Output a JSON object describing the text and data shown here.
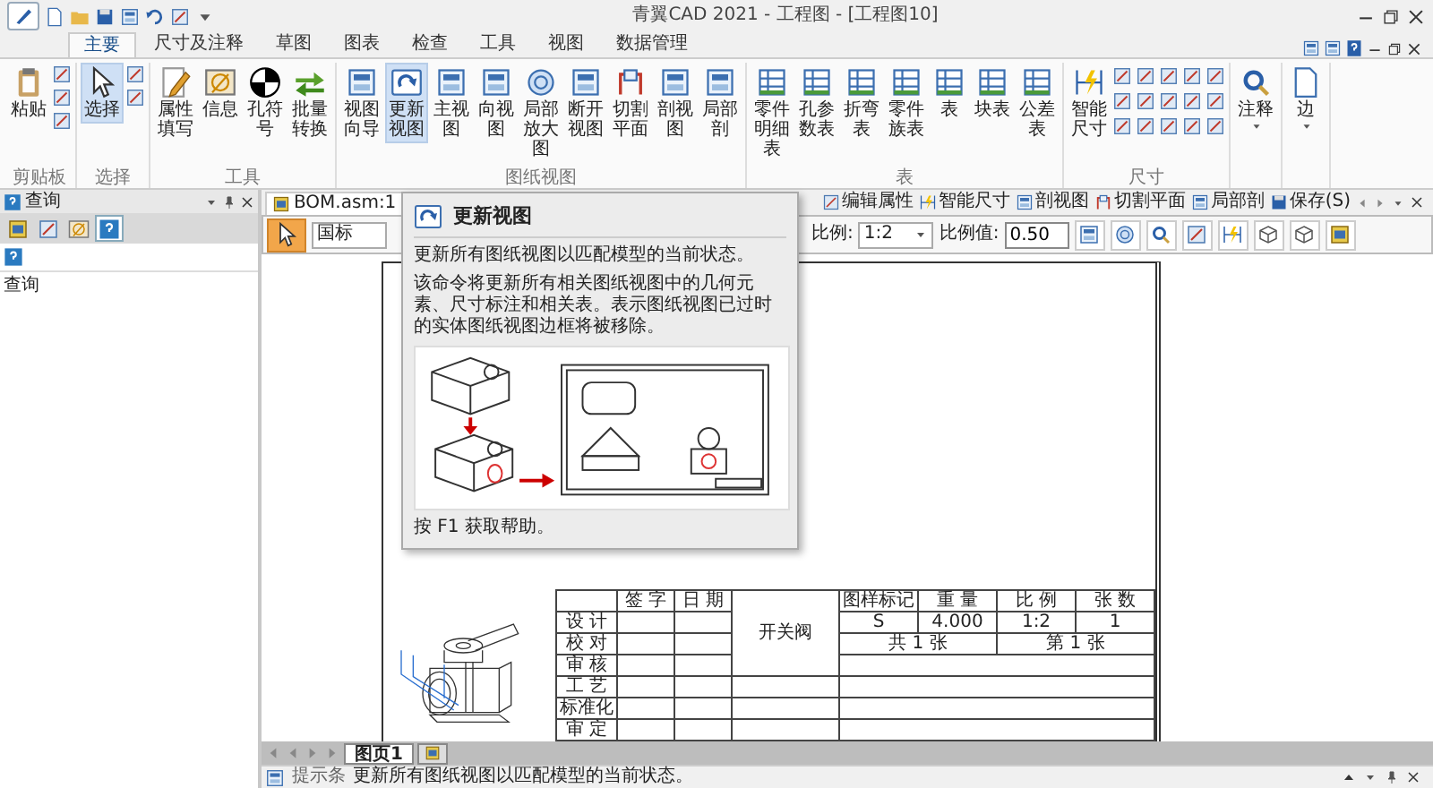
{
  "window": {
    "title": "青翼CAD 2021 - 工程图 - [工程图10]"
  },
  "ribbon_tabs": [
    {
      "label": "主要",
      "selected": true
    },
    {
      "label": "尺寸及注释",
      "selected": false
    },
    {
      "label": "草图",
      "selected": false
    },
    {
      "label": "图表",
      "selected": false
    },
    {
      "label": "检查",
      "selected": false
    },
    {
      "label": "工具",
      "selected": false
    },
    {
      "label": "视图",
      "selected": false
    },
    {
      "label": "数据管理",
      "selected": false
    }
  ],
  "ribbon_groups": [
    {
      "kind": "clipboard",
      "label": "剪贴板",
      "buttons": [
        {
          "label": "粘贴",
          "selected": false
        }
      ]
    },
    {
      "kind": "select",
      "label": "选择",
      "buttons": [
        {
          "label": "选择",
          "selected": true
        }
      ]
    },
    {
      "kind": "tools",
      "label": "工具",
      "buttons": [
        {
          "label": "属性填写",
          "selected": false
        },
        {
          "label": "信息",
          "selected": false
        },
        {
          "label": "孔符号",
          "selected": false
        },
        {
          "label": "批量转换",
          "selected": false
        }
      ]
    },
    {
      "kind": "views",
      "label": "图纸视图",
      "buttons": [
        {
          "label": "视图向导",
          "selected": false
        },
        {
          "label": "更新视图",
          "selected": true
        },
        {
          "label": "主视图",
          "selected": false
        },
        {
          "label": "向视图",
          "selected": false
        },
        {
          "label": "局部放大图",
          "selected": false
        },
        {
          "label": "断开视图",
          "selected": false
        },
        {
          "label": "切割平面",
          "selected": false
        },
        {
          "label": "剖视图",
          "selected": false
        },
        {
          "label": "局部剖",
          "selected": false
        }
      ]
    },
    {
      "kind": "tables",
      "label": "表",
      "buttons": [
        {
          "label": "零件明细表",
          "selected": false
        },
        {
          "label": "孔参数表",
          "selected": false
        },
        {
          "label": "折弯表",
          "selected": false
        },
        {
          "label": "零件族表",
          "selected": false
        },
        {
          "label": "表",
          "selected": false
        },
        {
          "label": "块表",
          "selected": false
        },
        {
          "label": "公差表",
          "selected": false
        }
      ]
    },
    {
      "kind": "dimensions",
      "label": "尺寸",
      "buttons": [
        {
          "label": "智能尺寸",
          "selected": false
        }
      ]
    },
    {
      "kind": "annotation",
      "buttons": [
        {
          "label": "注释",
          "selected": false
        }
      ]
    },
    {
      "kind": "edge",
      "buttons": [
        {
          "label": "边",
          "selected": false
        }
      ]
    }
  ],
  "left_panel": {
    "title": "查询",
    "tabs": [
      {
        "selected": false
      },
      {
        "selected": false
      },
      {
        "selected": false
      },
      {
        "selected": true
      }
    ],
    "item": "查询"
  },
  "document_tab": {
    "label": "BOM.asm:1"
  },
  "quick_toolbar": [
    {
      "label": "编辑属性"
    },
    {
      "label": "智能尺寸"
    },
    {
      "label": "剖视图"
    },
    {
      "label": "切割平面"
    },
    {
      "label": "局部剖"
    },
    {
      "label": "保存(S)"
    }
  ],
  "drawing_toolbar": {
    "select_active": true,
    "standard": "国标",
    "scale_label": "比例:",
    "scale": "1:2",
    "scale_value_label": "比例值:",
    "scale_value": "0.50"
  },
  "tooltip": {
    "title": "更新视图",
    "summary": "更新所有图纸视图以匹配模型的当前状态。",
    "description": "该命令将更新所有相关图纸视图中的几何元素、尺寸标注和相关表。表示图纸视图已过时的实体图纸视图边框将被移除。",
    "help": "按 F1 获取帮助。"
  },
  "title_block": {
    "headers": [
      "签 字",
      "日 期"
    ],
    "roles": [
      "设 计",
      "校 对",
      "审 核",
      "工 艺",
      "标准化",
      "审 定"
    ],
    "part_name": "开关阀",
    "attribute_labels": [
      "图样标记",
      "重 量",
      "比 例",
      "张 数"
    ],
    "attribute_values": [
      "S",
      "4.000",
      "1:2",
      "1"
    ],
    "sheet_count": "共 1 张",
    "sheet_number": "第 1 张"
  },
  "sheet_tabs": [
    {
      "label": "图页1",
      "selected": true
    },
    {
      "selected": false
    }
  ],
  "status_bar": {
    "label": "提示条",
    "message": "更新所有图纸视图以匹配模型的当前状态。"
  }
}
